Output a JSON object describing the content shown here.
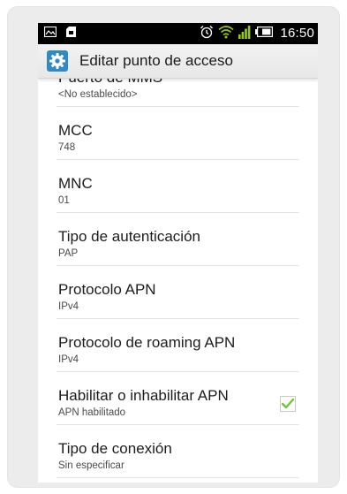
{
  "status_bar": {
    "time": "16:50",
    "icons": [
      "image-icon",
      "sd-card-icon",
      "alarm-icon",
      "wifi-icon",
      "signal-icon",
      "battery-icon"
    ]
  },
  "action_bar": {
    "title": "Editar punto de acceso",
    "icon": "settings-gear-icon"
  },
  "colors": {
    "accent": "#2f88c8",
    "signal": "#99cc00",
    "check": "#6ec43a"
  },
  "settings": [
    {
      "title": "Puerto de MMS",
      "summary": "<No establecido>"
    },
    {
      "title": "MCC",
      "summary": "748"
    },
    {
      "title": "MNC",
      "summary": "01"
    },
    {
      "title": "Tipo de autenticación",
      "summary": "PAP"
    },
    {
      "title": "Protocolo APN",
      "summary": "IPv4"
    },
    {
      "title": "Protocolo de roaming APN",
      "summary": "IPv4"
    },
    {
      "title": "Habilitar o inhabilitar APN",
      "summary": "APN habilitado",
      "checked": true
    },
    {
      "title": "Tipo de conexión",
      "summary": "Sin especificar"
    }
  ]
}
